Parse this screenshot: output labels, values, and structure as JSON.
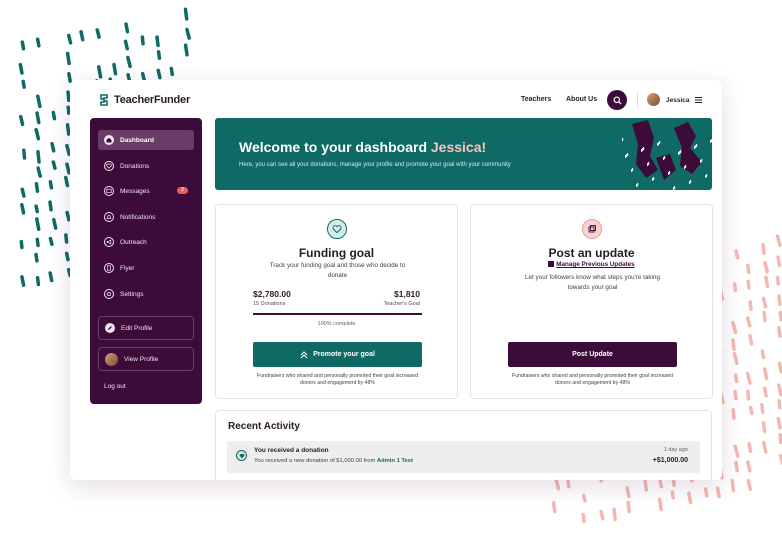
{
  "brand": {
    "name": "TeacherFunder",
    "primary": "#3d0b3a",
    "teal": "#0f6a66",
    "accent": "#f8c4c1"
  },
  "topnav": {
    "teachers": "Teachers",
    "about": "About Us",
    "user": "Jessica"
  },
  "sidebar": {
    "items": [
      {
        "label": "Dashboard",
        "icon": "home-icon"
      },
      {
        "label": "Donations",
        "icon": "heart-icon"
      },
      {
        "label": "Messages",
        "icon": "message-icon",
        "badge": "2"
      },
      {
        "label": "Notifications",
        "icon": "bell-icon"
      },
      {
        "label": "Outreach",
        "icon": "megaphone-icon"
      },
      {
        "label": "Flyer",
        "icon": "flyer-icon"
      },
      {
        "label": "Settings",
        "icon": "gear-icon"
      }
    ],
    "edit_profile": "Edit Profile",
    "view_profile": "View Profile",
    "logout": "Log out"
  },
  "hero": {
    "title_prefix": "Welcome to your dashboard",
    "title_name": "Jessica!",
    "subtitle": "Here, you can see all your donations, manage your profile and promote your goal with your community"
  },
  "funding": {
    "title": "Funding goal",
    "desc": "Track your funding goal and those who decide to donate",
    "raised": "$2,780.00",
    "donations": "15 Donations",
    "goal": "$1,810",
    "goal_label": "Teacher's Goal",
    "progress_pct": 100,
    "progress_text": "100% complete",
    "button": "Promote your goal",
    "note": "Fundraisers who shared and personally promoted their goal increased donors and engagement by 48%"
  },
  "update": {
    "title": "Post an update",
    "manage": "Manage Previous Updates",
    "desc": "Let your followers know what steps you're taking towards your goal",
    "button": "Post Update",
    "note": "Fundraisers who shared and personally promoted their goal increased donors and engagement by 48%"
  },
  "activity": {
    "title": "Recent Activity",
    "items": [
      {
        "head": "You received a donation",
        "body_prefix": "You received a new donation of $1,000.00 from",
        "who": "Admin 1 Test",
        "time": "1 day ago",
        "amount": "+$1,000.00"
      }
    ]
  }
}
